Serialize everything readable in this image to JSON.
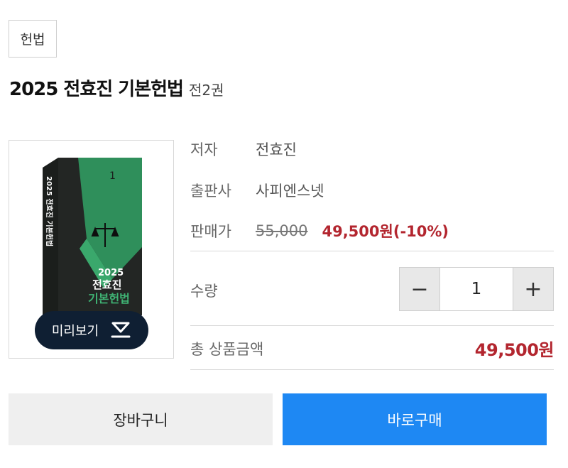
{
  "category": {
    "tag": "헌법"
  },
  "product": {
    "title": "2025 전효진 기본헌법",
    "volume": "전2권"
  },
  "cover": {
    "book_spine_text": "2025 전효진 기본헌법",
    "book_front_year": "2025",
    "book_front_author": "전효진",
    "book_front_title": "기본헌법",
    "book_volume_number": "1",
    "preview_label": "미리보기"
  },
  "info": {
    "author_label": "저자",
    "author_value": "전효진",
    "publisher_label": "출판사",
    "publisher_value": "사피엔스넷",
    "price_label": "판매가",
    "original_price": "55,000",
    "sale_price": "49,500원(-10%)"
  },
  "quantity": {
    "label": "수량",
    "value": "1",
    "decrease_symbol": "−",
    "increase_symbol": "+"
  },
  "total": {
    "label": "총 상품금액",
    "value": "49,500원"
  },
  "actions": {
    "cart_label": "장바구니",
    "buy_label": "바로구매"
  },
  "colors": {
    "accent_red": "#b3262f",
    "buy_blue": "#1e88f3",
    "book_green": "#2f8f5b",
    "preview_navy": "#0f1f33"
  }
}
